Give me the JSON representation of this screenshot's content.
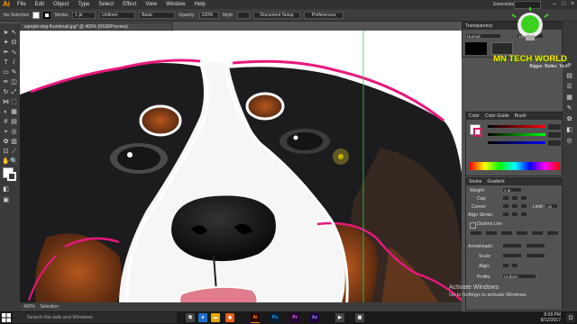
{
  "menubar": {
    "logo": "Ai",
    "items": [
      "File",
      "Edit",
      "Object",
      "Type",
      "Select",
      "Effect",
      "View",
      "Window",
      "Help"
    ],
    "workspace": "Essentials"
  },
  "controlbar": {
    "selection": "No Selection",
    "stroke_label": "Stroke:",
    "stroke_value": "1 pt",
    "profile": "Uniform",
    "brush": "Basic",
    "opacity_label": "Opacity:",
    "opacity_value": "100%",
    "style_label": "Style:",
    "doc_setup": "Document Setup",
    "preferences": "Preferences"
  },
  "document": {
    "tab_title": "sample-dog-thumbnail.jpg* @ 400% (RGB/Preview)"
  },
  "transparency_panel": {
    "title": "Transparency",
    "mode": "Normal",
    "opacity": "100%"
  },
  "color_panel": {
    "tabs": [
      "Color",
      "Color Guide",
      "Brush"
    ],
    "swatches": [
      "#ffffff",
      "#000000",
      "#d81b60"
    ]
  },
  "stroke_panel": {
    "tabs": [
      "Stroke",
      "Gradient"
    ],
    "weight_label": "Weight:",
    "weight_value": "1 pt",
    "cap_label": "Cap:",
    "corner_label": "Corner:",
    "limit_label": "Limit:",
    "limit_value": "10",
    "align_label": "Align Stroke:",
    "dashed_label": "Dashed Line",
    "arrowheads_label": "Arrowheads:",
    "scale_label": "Scale:",
    "align2_label": "Align:",
    "profile_label": "Profile:",
    "profile_value": "Uniform"
  },
  "statusbar": {
    "zoom": "400%",
    "mode": "Selection"
  },
  "taskbar": {
    "search_placeholder": "Search the web and Windows",
    "apps": [
      "Ai",
      "Ps",
      "Pr",
      "Ae"
    ],
    "time": "8:08 PM",
    "date": "8/12/2017"
  },
  "watermark": {
    "brand": "MN TECH WORLD",
    "tagline": "Bigger. Better. Tech."
  },
  "activation": {
    "line1": "Activate Windows",
    "line2": "Go to Settings to activate Windows."
  },
  "colors": {
    "accent_pink": "#e8187c",
    "ui_dark": "#323232",
    "illustrator_orange": "#ff9a00"
  }
}
